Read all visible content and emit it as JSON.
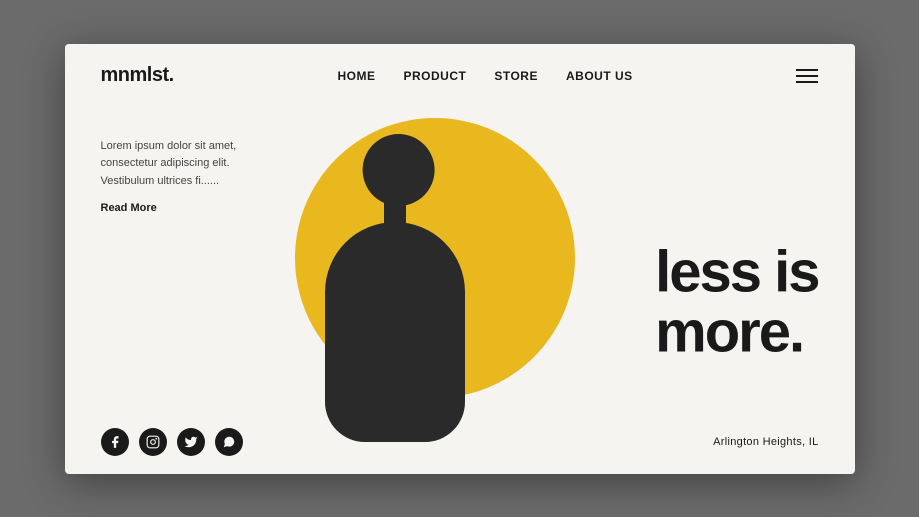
{
  "brand": {
    "logo": "mnmlst."
  },
  "navbar": {
    "links": [
      {
        "label": "HOME",
        "href": "#"
      },
      {
        "label": "PRODUCT",
        "href": "#"
      },
      {
        "label": "STORE",
        "href": "#"
      },
      {
        "label": "ABOUT US",
        "href": "#"
      }
    ]
  },
  "hero": {
    "headline_line1": "less is",
    "headline_line2": "more.",
    "description": "Lorem ipsum dolor sit amet, consectetur adipiscing elit. Vestibulum ultrices fi......",
    "read_more": "Read More",
    "location": "Arlington Heights, IL"
  },
  "social": {
    "icons": [
      "facebook",
      "instagram",
      "twitter",
      "whatsapp"
    ]
  }
}
